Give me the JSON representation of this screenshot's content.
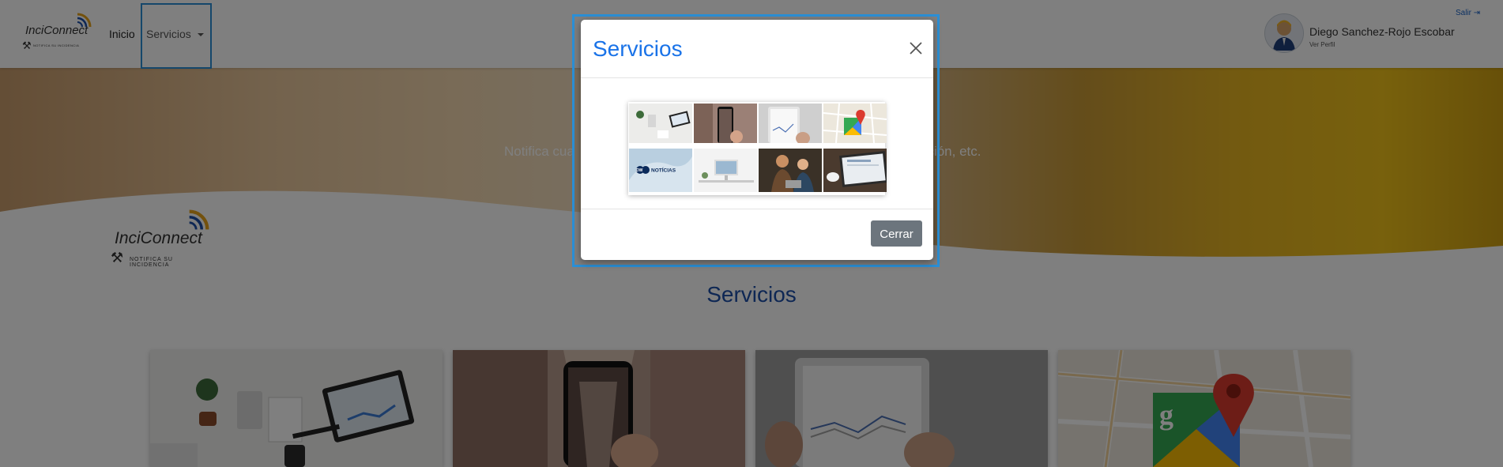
{
  "navbar": {
    "logo_brand": "InciConnect",
    "logo_tagline": "NOTIFICA SU INCIDENCIA",
    "inicio_label": "Inicio",
    "servicios_label": "Servicios"
  },
  "user": {
    "name": "Diego Sanchez-Rojo Escobar",
    "profile_link": "Ver Perfil",
    "logout_label": "Salir"
  },
  "hero": {
    "visible_text_left": "Notifica cua",
    "visible_text_right": "ación, etc."
  },
  "section": {
    "logo_brand": "InciConnect",
    "logo_tagline": "NOTIFICA SU INCIDENCIA",
    "title": "Servicios"
  },
  "modal": {
    "title": "Servicios",
    "close_button": "Cerrar",
    "thumbnails": [
      {
        "name": "office-desk-thumbnail"
      },
      {
        "name": "phone-arcade-thumbnail"
      },
      {
        "name": "tablet-chart-thumbnail"
      },
      {
        "name": "google-maps-thumbnail"
      },
      {
        "name": "dw-noticias-thumbnail",
        "label": "NOTÍCIAS"
      },
      {
        "name": "workspace-desk-thumbnail"
      },
      {
        "name": "team-meeting-thumbnail"
      },
      {
        "name": "laptop-coffee-thumbnail"
      }
    ]
  },
  "colors": {
    "accent_blue": "#1a73e8",
    "focus_outline": "#2b8fd6",
    "section_title": "#1d4fa8",
    "button_secondary": "#6c757d"
  }
}
